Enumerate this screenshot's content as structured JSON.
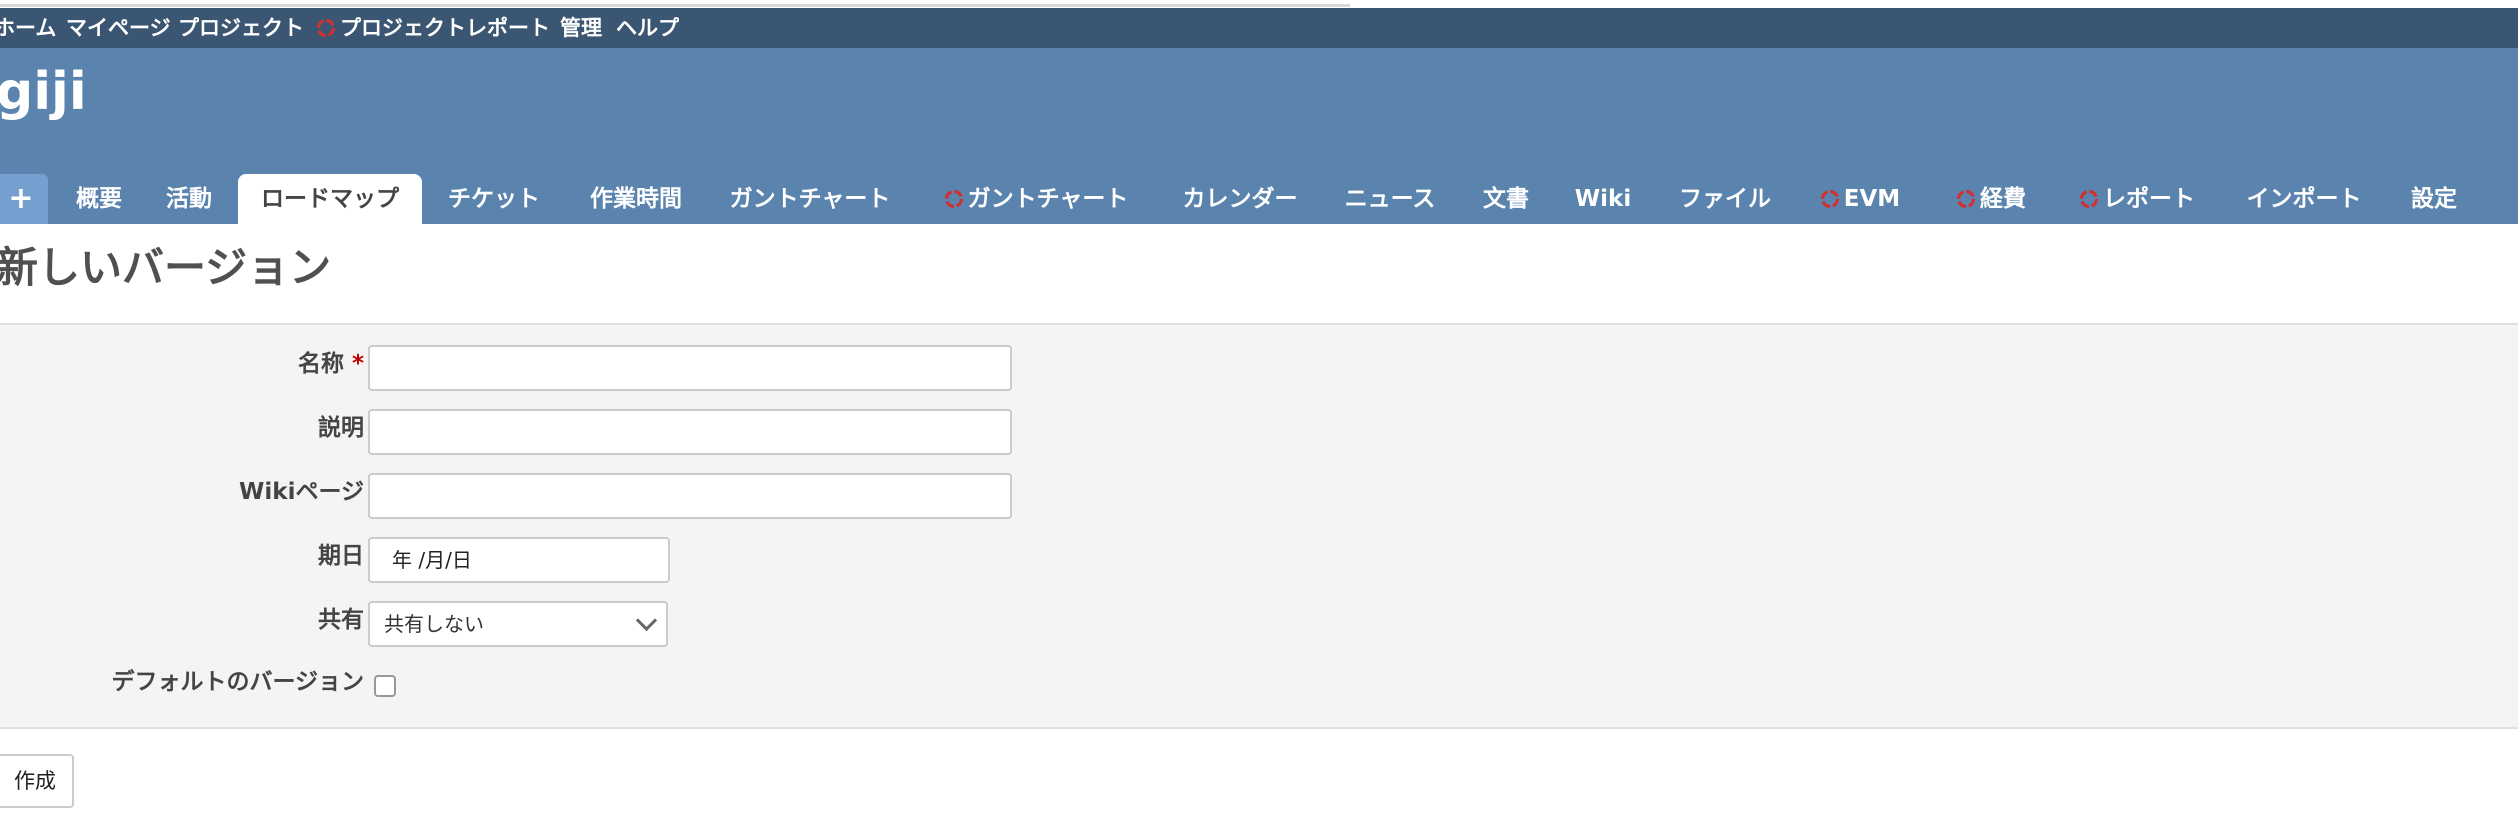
{
  "top_menu": {
    "items": [
      {
        "label": "ホーム"
      },
      {
        "label": "マイページ"
      },
      {
        "label": "プロジェクト"
      },
      {
        "label": "プロジェクトレポート",
        "icon": "redmine-icon"
      },
      {
        "label": "管理"
      },
      {
        "label": "ヘルプ"
      }
    ]
  },
  "header": {
    "project_title": "giji"
  },
  "main_menu": {
    "new_object": "+",
    "tabs": [
      {
        "label": "概要"
      },
      {
        "label": "活動"
      },
      {
        "label": "ロードマップ",
        "selected": true
      },
      {
        "label": "チケット"
      },
      {
        "label": "作業時間"
      },
      {
        "label": "ガントチャート"
      },
      {
        "label": "ガントチャート",
        "icon": "redmine-icon"
      },
      {
        "label": "カレンダー"
      },
      {
        "label": "ニュース"
      },
      {
        "label": "文書"
      },
      {
        "label": "Wiki"
      },
      {
        "label": "ファイル"
      },
      {
        "label": "EVM",
        "icon": "redmine-icon"
      },
      {
        "label": "経費",
        "icon": "redmine-icon"
      },
      {
        "label": "レポート",
        "icon": "redmine-icon"
      },
      {
        "label": "インポート"
      },
      {
        "label": "設定"
      }
    ]
  },
  "page": {
    "title": "新しいバージョン"
  },
  "form": {
    "name": {
      "label": "名称",
      "required_mark": "*",
      "value": ""
    },
    "description": {
      "label": "説明",
      "value": ""
    },
    "wiki_page": {
      "label": "Wikiページ",
      "value": ""
    },
    "due_date": {
      "label": "期日",
      "value": "年 /月/日"
    },
    "sharing": {
      "label": "共有",
      "selected": "共有しない"
    },
    "default_version": {
      "label": "デフォルトのバージョン",
      "checked": false
    }
  },
  "actions": {
    "create_label": "作成"
  },
  "colors": {
    "top_menu_bg": "#3b5672",
    "header_bg": "#5a83ad",
    "required": "#bb0000",
    "redmine_icon": "#cc2222"
  }
}
